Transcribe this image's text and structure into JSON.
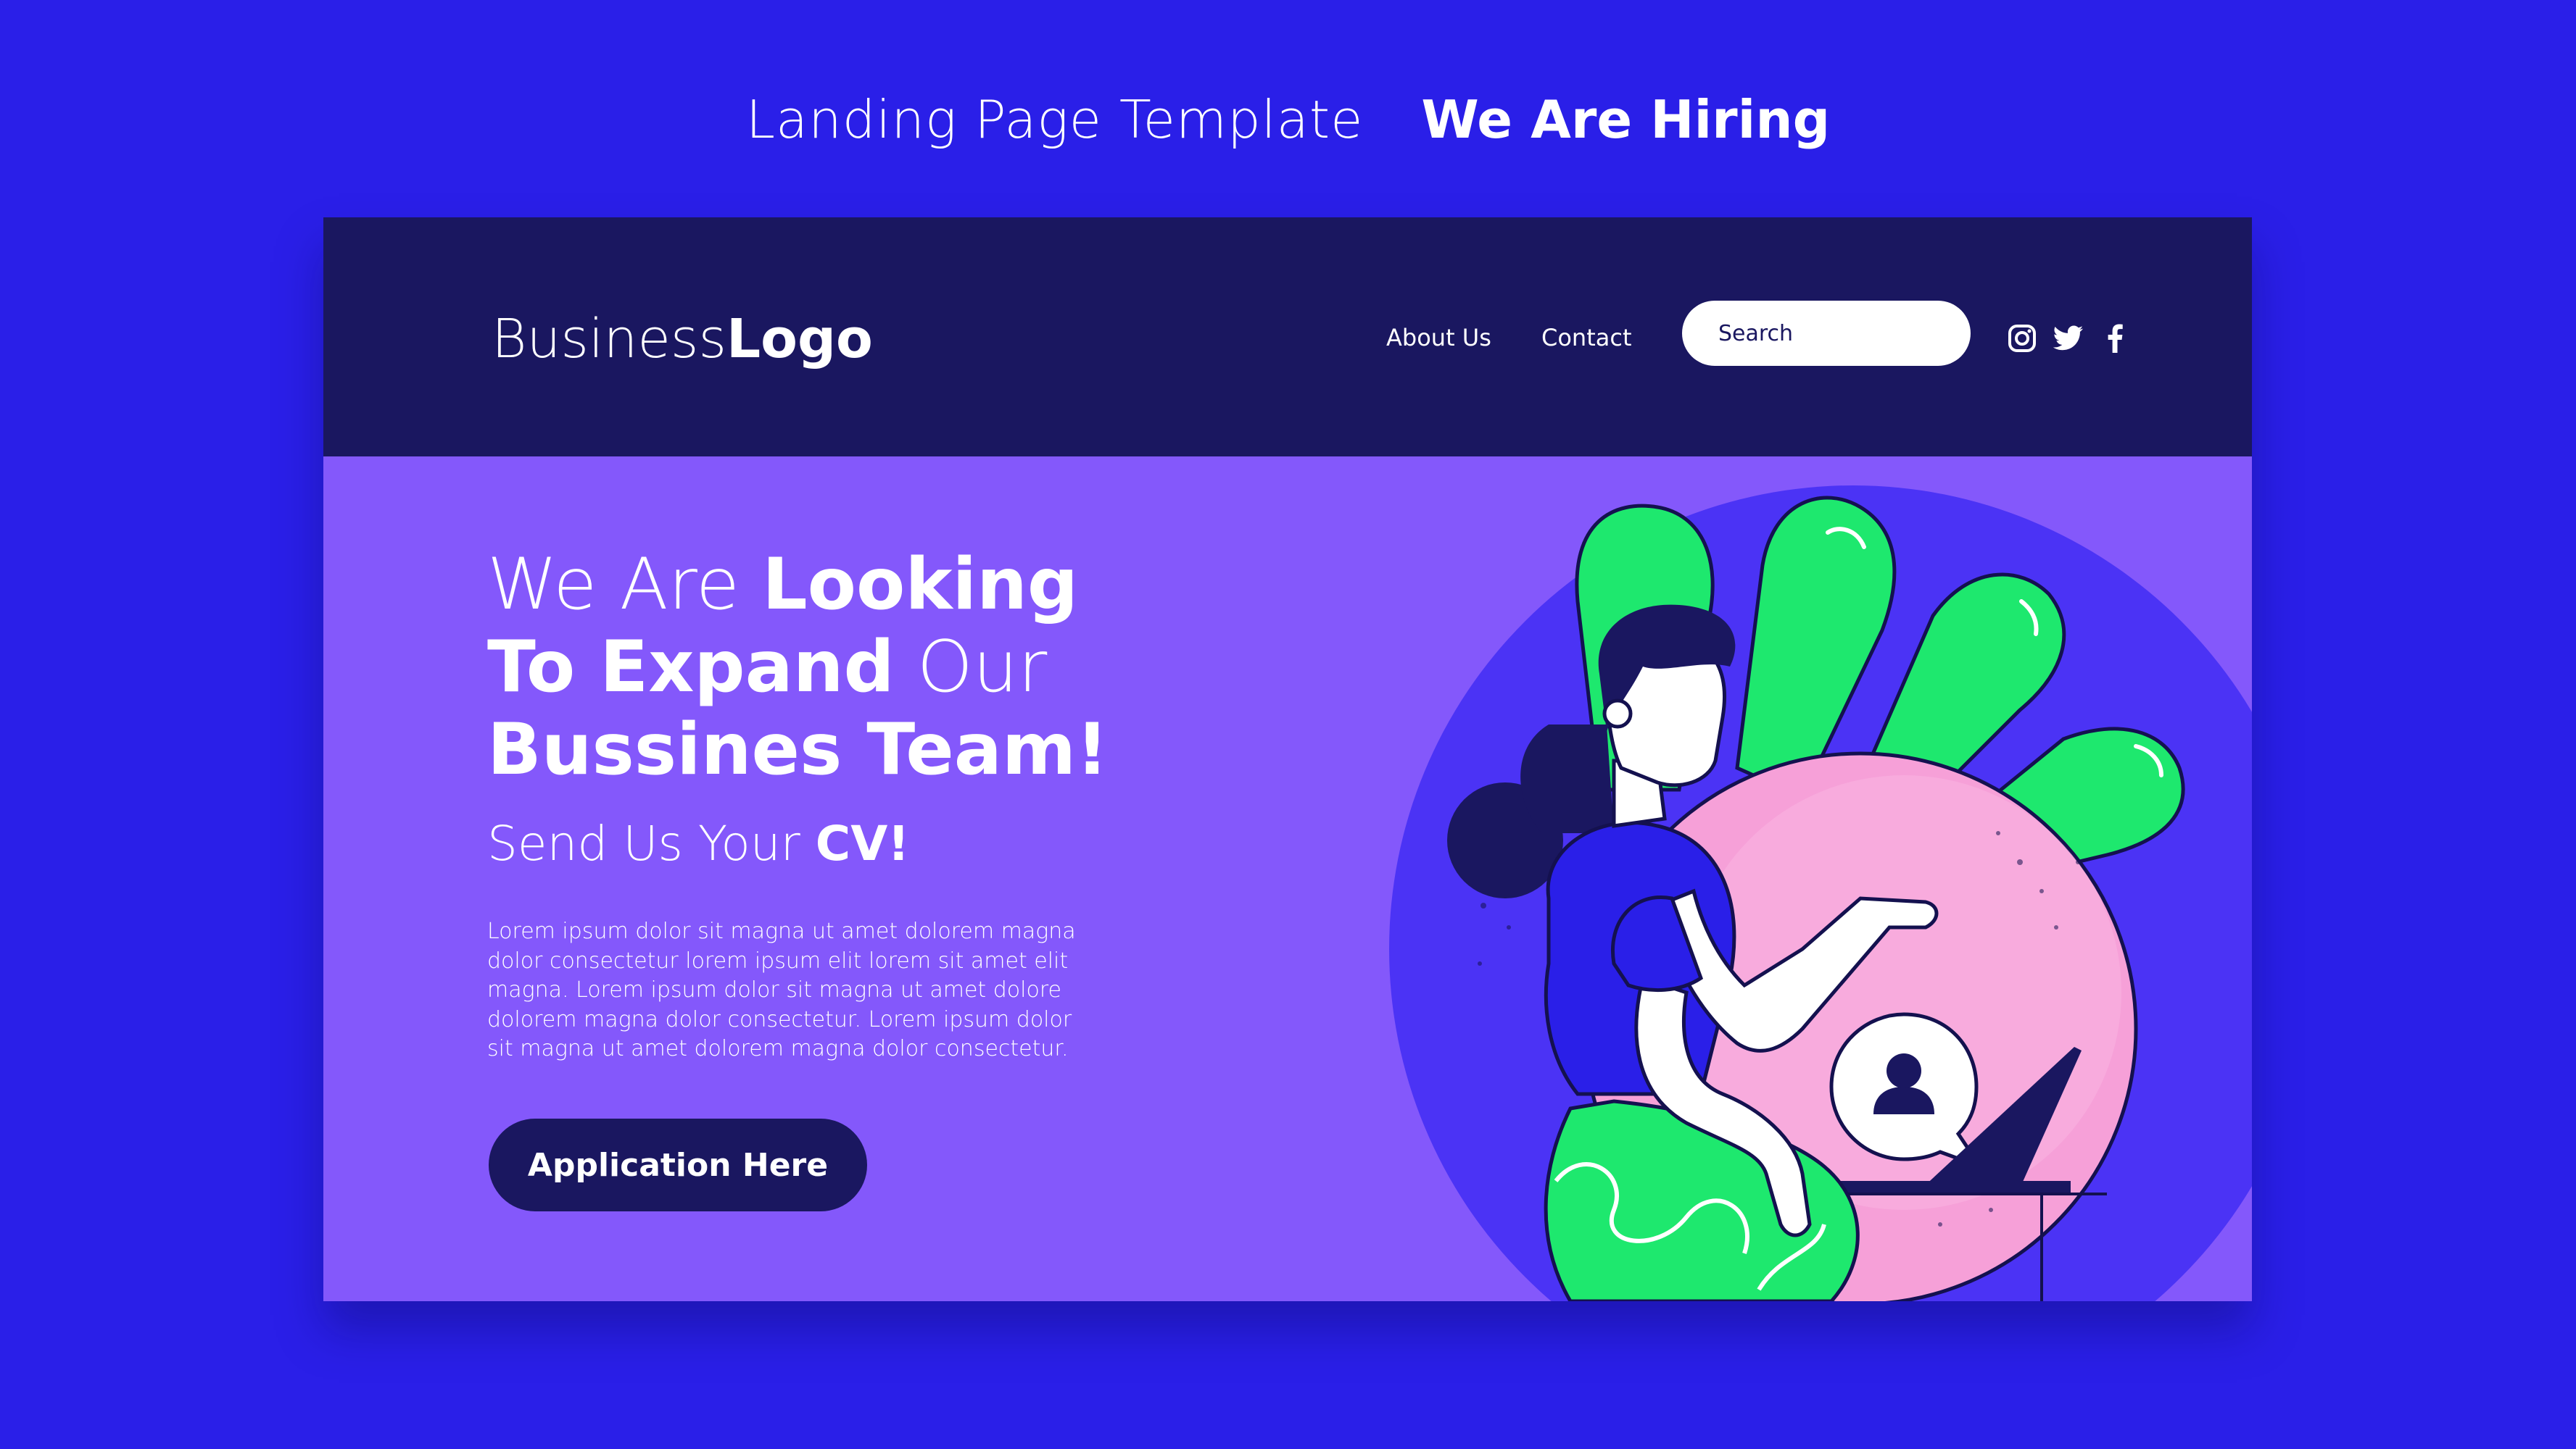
{
  "page_header": {
    "light_text": "Landing Page Template",
    "bold_text": "We Are Hiring"
  },
  "navbar": {
    "logo_light": "Business",
    "logo_bold": "Logo",
    "links": [
      {
        "label": "About Us"
      },
      {
        "label": "Contact"
      }
    ],
    "search": {
      "placeholder": "Search"
    },
    "social_icons": [
      "instagram-icon",
      "twitter-icon",
      "facebook-icon"
    ]
  },
  "hero": {
    "headline": {
      "part1": "We Are ",
      "part2": "Looking",
      "part3": "To Expand",
      "part4": " Our",
      "part5": "Bussines Team!"
    },
    "subheadline": {
      "part1": "Send Us Your ",
      "part2": "CV!"
    },
    "body": "Lorem ipsum dolor sit magna ut amet dolorem magna dolor consectetur lorem ipsum elit lorem sit amet elit magna. Lorem ipsum dolor sit magna ut amet dolore dolorem magna dolor consectetur. Lorem ipsum dolor sit magna ut amet dolorem magna dolor consectetur.",
    "cta_label": "Application Here"
  },
  "colors": {
    "page_background": "#2a1fe8",
    "navbar": "#1a1760",
    "hero": "#8458fb",
    "accent_green": "#1ee86e",
    "accent_pink": "#f6a0d8",
    "shirt_blue": "#2a1fe8"
  }
}
